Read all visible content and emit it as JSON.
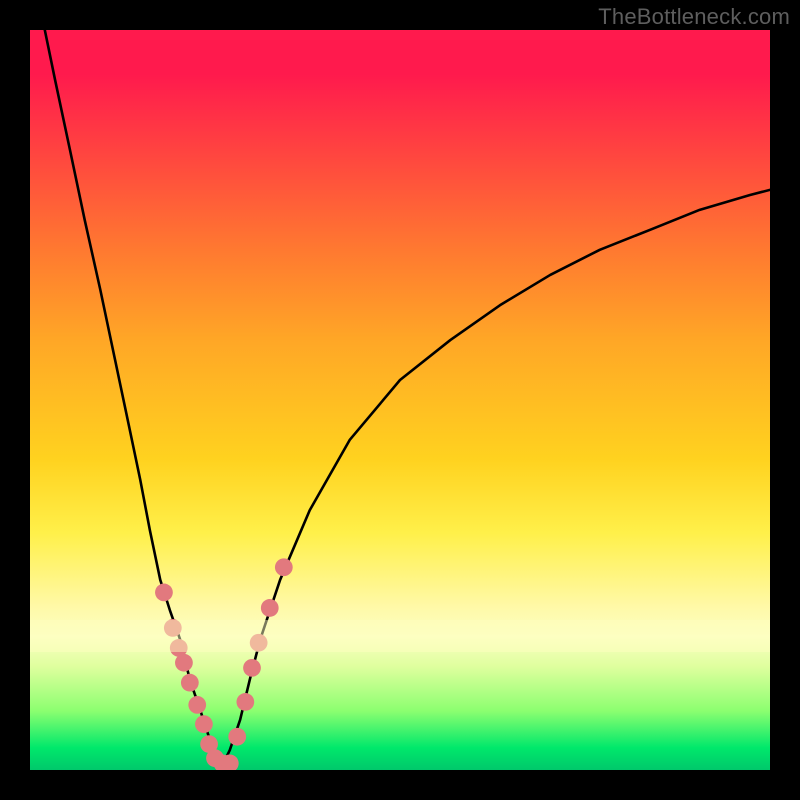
{
  "watermark": "TheBottleneck.com",
  "chart_data": {
    "type": "line",
    "title": "",
    "xlabel": "",
    "ylabel": "",
    "xlim": [
      0,
      100
    ],
    "ylim": [
      0,
      100
    ],
    "note": "Axes are unlabeled; values estimated from pixel positions in a 740×740 plot area. y=0 at bottom, x=0 at left. Percent units.",
    "series": [
      {
        "name": "left-curve",
        "x": [
          2.0,
          3.4,
          5.4,
          7.4,
          9.5,
          11.5,
          13.5,
          14.9,
          16.2,
          17.6,
          18.9,
          20.3,
          21.6,
          23.0,
          24.3,
          25.0,
          25.7
        ],
        "y": [
          100.0,
          93.2,
          83.8,
          74.3,
          64.9,
          55.4,
          45.9,
          39.2,
          32.4,
          25.7,
          21.6,
          17.6,
          12.2,
          8.1,
          4.1,
          1.4,
          0.0
        ]
      },
      {
        "name": "right-curve",
        "x": [
          25.7,
          27.0,
          28.4,
          29.7,
          31.1,
          33.8,
          37.8,
          43.2,
          50.0,
          56.8,
          63.5,
          70.3,
          77.0,
          83.8,
          90.5,
          97.3,
          100.0
        ],
        "y": [
          0.0,
          2.7,
          6.8,
          12.2,
          17.6,
          25.7,
          35.1,
          44.6,
          52.7,
          58.1,
          62.8,
          66.9,
          70.3,
          73.0,
          75.7,
          77.7,
          78.4
        ]
      }
    ],
    "markers": {
      "name": "pink-dots",
      "color": "#e2797e",
      "radius_pct": 1.2,
      "points": [
        {
          "x": 18.1,
          "y": 24.0
        },
        {
          "x": 19.3,
          "y": 19.2
        },
        {
          "x": 20.1,
          "y": 16.5
        },
        {
          "x": 20.8,
          "y": 14.5
        },
        {
          "x": 21.6,
          "y": 11.8
        },
        {
          "x": 22.6,
          "y": 8.8
        },
        {
          "x": 23.5,
          "y": 6.2
        },
        {
          "x": 24.2,
          "y": 3.5
        },
        {
          "x": 25.0,
          "y": 1.6
        },
        {
          "x": 26.0,
          "y": 0.9
        },
        {
          "x": 27.0,
          "y": 0.9
        },
        {
          "x": 28.0,
          "y": 4.5
        },
        {
          "x": 29.1,
          "y": 9.2
        },
        {
          "x": 30.0,
          "y": 13.8
        },
        {
          "x": 30.9,
          "y": 17.2
        },
        {
          "x": 32.4,
          "y": 21.9
        },
        {
          "x": 34.3,
          "y": 27.4
        }
      ]
    },
    "gradient_stops": [
      {
        "pos": 0.0,
        "color": "#ff1a4d"
      },
      {
        "pos": 0.06,
        "color": "#ff1a4d"
      },
      {
        "pos": 0.18,
        "color": "#ff4a3e"
      },
      {
        "pos": 0.3,
        "color": "#ff7a30"
      },
      {
        "pos": 0.42,
        "color": "#ffa726"
      },
      {
        "pos": 0.58,
        "color": "#ffd21f"
      },
      {
        "pos": 0.68,
        "color": "#fff04a"
      },
      {
        "pos": 0.78,
        "color": "#fff9a8"
      },
      {
        "pos": 0.82,
        "color": "#fbffc2"
      },
      {
        "pos": 0.86,
        "color": "#dfff9e"
      },
      {
        "pos": 0.92,
        "color": "#8cff70"
      },
      {
        "pos": 0.97,
        "color": "#00e86b"
      },
      {
        "pos": 1.0,
        "color": "#00c86b"
      }
    ]
  }
}
